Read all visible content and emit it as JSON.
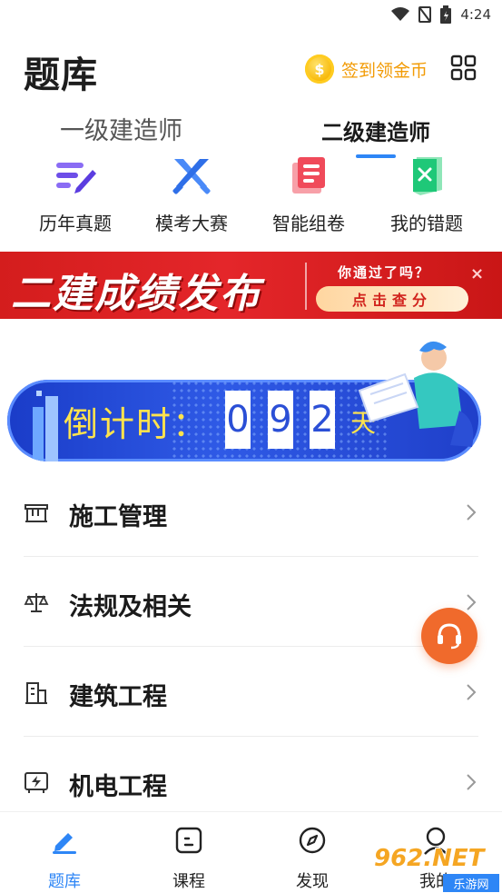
{
  "status_bar": {
    "time": "4:24"
  },
  "header": {
    "title": "题库",
    "signin_label": "签到领金币",
    "coin_symbol": "$"
  },
  "level_tabs": [
    {
      "label": "一级建造师",
      "active": false
    },
    {
      "label": "二级建造师",
      "active": true
    }
  ],
  "features": [
    {
      "label": "历年真题",
      "icon": "pen-lines-icon",
      "color": "#7b5cf0"
    },
    {
      "label": "模考大赛",
      "icon": "crossed-swords-icon",
      "color": "#3b7cf6"
    },
    {
      "label": "智能组卷",
      "icon": "document-icon",
      "color": "#f04a5a"
    },
    {
      "label": "我的错题",
      "icon": "wrong-note-icon",
      "color": "#1fc878"
    }
  ],
  "banner": {
    "title": "二建成绩发布",
    "subtitle": "你通过了吗？",
    "button": "点击查分",
    "close": "×"
  },
  "countdown": {
    "label": "倒计时：",
    "digits": [
      "0",
      "9",
      "2"
    ],
    "unit": "天"
  },
  "subjects": [
    {
      "label": "施工管理",
      "icon": "fence-icon"
    },
    {
      "label": "法规及相关",
      "icon": "scale-icon"
    },
    {
      "label": "建筑工程",
      "icon": "building-icon"
    },
    {
      "label": "机电工程",
      "icon": "electric-icon"
    }
  ],
  "bottom_nav": [
    {
      "label": "题库",
      "icon": "pencil-icon",
      "active": true
    },
    {
      "label": "课程",
      "icon": "course-icon",
      "active": false
    },
    {
      "label": "发现",
      "icon": "compass-icon",
      "active": false
    },
    {
      "label": "我的",
      "icon": "user-icon",
      "active": false
    }
  ],
  "watermark": {
    "top": "962.NET",
    "bottom": "乐游网"
  },
  "colors": {
    "accent": "#2e86f6",
    "signin": "#f29b05",
    "banner": "#d41d1d",
    "service": "#f06a2c"
  }
}
